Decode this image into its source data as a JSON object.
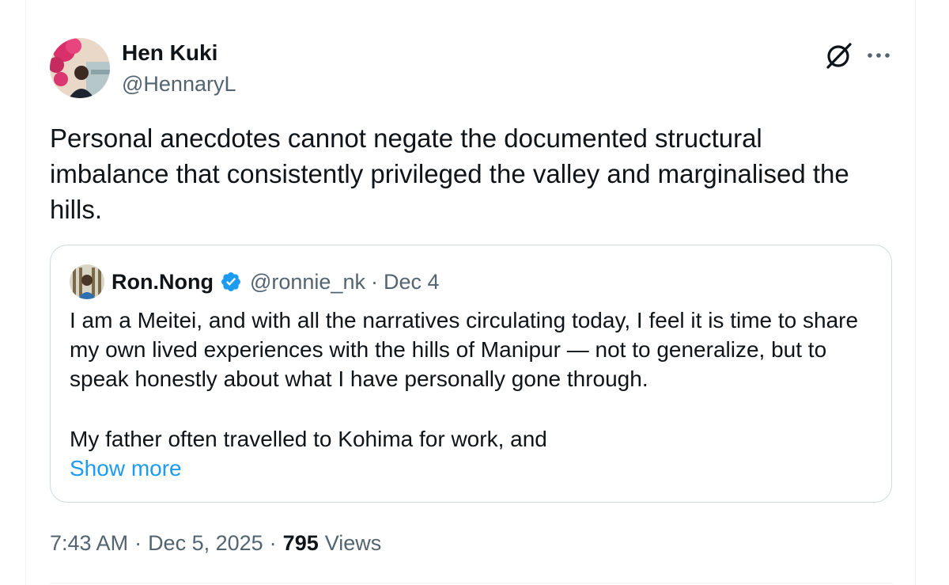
{
  "tweet": {
    "author": {
      "display_name": "Hen Kuki",
      "handle": "@HennaryL",
      "avatar_icon": "profile-photo"
    },
    "text": "Personal anecdotes cannot negate the documented structural imbalance that consistently privileged the valley and marginalised the hills.",
    "actions": {
      "grok_icon": "grok-icon",
      "more_icon": "more-options-icon"
    },
    "meta": {
      "time": "7:43 AM",
      "separator": "·",
      "date": "Dec 5, 2025",
      "views_count": "795",
      "views_label": "Views"
    }
  },
  "quoted_tweet": {
    "author": {
      "display_name": "Ron.Nong",
      "handle": "@ronnie_nk",
      "verified_icon": "verified-badge-icon"
    },
    "separator": "·",
    "date": "Dec 4",
    "text_paragraph_1": "I am a Meitei, and with all the narratives circulating today, I feel it is time to share my own lived experiences with the hills of Manipur — not to generalize, but to speak honestly about what I have personally gone through.",
    "text_paragraph_2": "My father often travelled to Kohima for work, and",
    "show_more_label": "Show more"
  },
  "colors": {
    "text_primary": "#0f1419",
    "text_secondary": "#536471",
    "link": "#1d9bf0",
    "border": "#cfd9de",
    "verified": "#1d9bf0"
  }
}
